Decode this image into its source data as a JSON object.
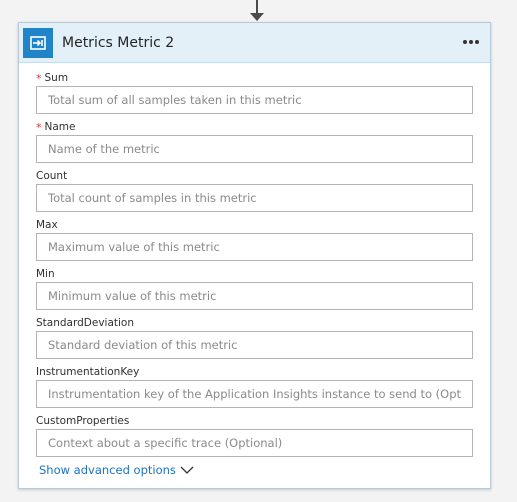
{
  "card": {
    "title": "Metrics Metric 2",
    "icon": "connector-action-icon",
    "accent": "#1f85c8",
    "more_menu": "more-options-icon"
  },
  "fields": [
    {
      "label": "Sum",
      "required": true,
      "placeholder": "Total sum of all samples taken in this metric",
      "value": ""
    },
    {
      "label": "Name",
      "required": true,
      "placeholder": "Name of the metric",
      "value": ""
    },
    {
      "label": "Count",
      "required": false,
      "placeholder": "Total count of samples in this metric",
      "value": ""
    },
    {
      "label": "Max",
      "required": false,
      "placeholder": "Maximum value of this metric",
      "value": ""
    },
    {
      "label": "Min",
      "required": false,
      "placeholder": "Minimum value of this metric",
      "value": ""
    },
    {
      "label": "StandardDeviation",
      "required": false,
      "placeholder": "Standard deviation of this metric",
      "value": ""
    },
    {
      "label": "InstrumentationKey",
      "required": false,
      "placeholder": "Instrumentation key of the Application Insights instance to send to (Optional)",
      "value": ""
    },
    {
      "label": "CustomProperties",
      "required": false,
      "placeholder": "Context about a specific trace (Optional)",
      "value": ""
    }
  ],
  "required_marker": "*",
  "advanced_options": {
    "label": "Show advanced options",
    "icon": "chevron-down-icon"
  },
  "colors": {
    "header_bg": "#e3f0f8",
    "link": "#1b74c2",
    "required": "#d13438"
  }
}
